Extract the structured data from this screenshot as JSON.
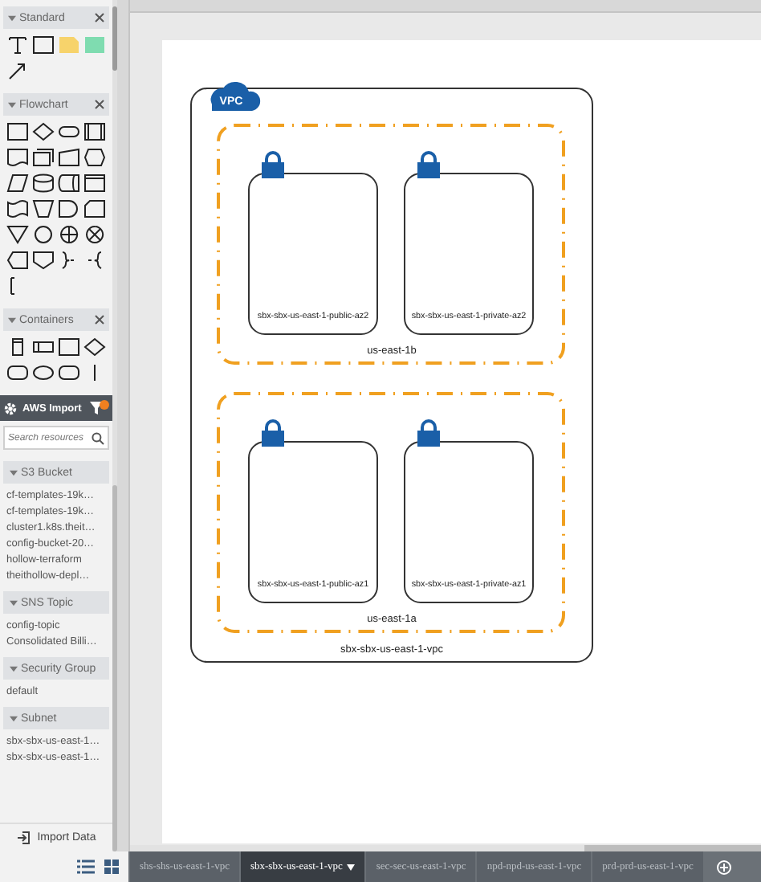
{
  "palettes": [
    {
      "title": "Standard",
      "expanded": true,
      "kind": "standard"
    },
    {
      "title": "Flowchart",
      "expanded": true,
      "kind": "flowchart"
    },
    {
      "title": "Containers",
      "expanded": true,
      "kind": "containers"
    }
  ],
  "aws_import": {
    "title": "AWS Import",
    "search": {
      "placeholder": "Search resources"
    },
    "groups": [
      {
        "title": "S3 Bucket",
        "expanded": true,
        "items": [
          "cf-templates-19k…",
          "cf-templates-19k…",
          "cluster1.k8s.theit…",
          "config-bucket-20…",
          "hollow-terraform",
          "theithollow-depl…"
        ]
      },
      {
        "title": "SNS Topic",
        "expanded": true,
        "items": [
          "config-topic",
          "Consolidated Billi…"
        ]
      },
      {
        "title": "Security Group",
        "expanded": true,
        "items": [
          "default"
        ]
      },
      {
        "title": "Subnet",
        "expanded": true,
        "items": [
          "sbx-sbx-us-east-1…",
          "sbx-sbx-us-east-1…"
        ]
      }
    ],
    "import_button": "Import Data"
  },
  "diagram": {
    "vpc": {
      "badge": "VPC",
      "label": "sbx-sbx-us-east-1-vpc"
    },
    "zones": [
      {
        "label": "us-east-1b",
        "subnets": [
          "sbx-sbx-us-east-1-public-az2",
          "sbx-sbx-us-east-1-private-az2"
        ]
      },
      {
        "label": "us-east-1a",
        "subnets": [
          "sbx-sbx-us-east-1-public-az1",
          "sbx-sbx-us-east-1-private-az1"
        ]
      }
    ]
  },
  "tabs": [
    {
      "label": "shs-shs-us-east-1-vpc",
      "selected": false
    },
    {
      "label": "sbx-sbx-us-east-1-vpc",
      "selected": true
    },
    {
      "label": "sec-sec-us-east-1-vpc",
      "selected": false
    },
    {
      "label": "npd-npd-us-east-1-vpc",
      "selected": false
    },
    {
      "label": "prd-prd-us-east-1-vpc",
      "selected": false
    }
  ]
}
